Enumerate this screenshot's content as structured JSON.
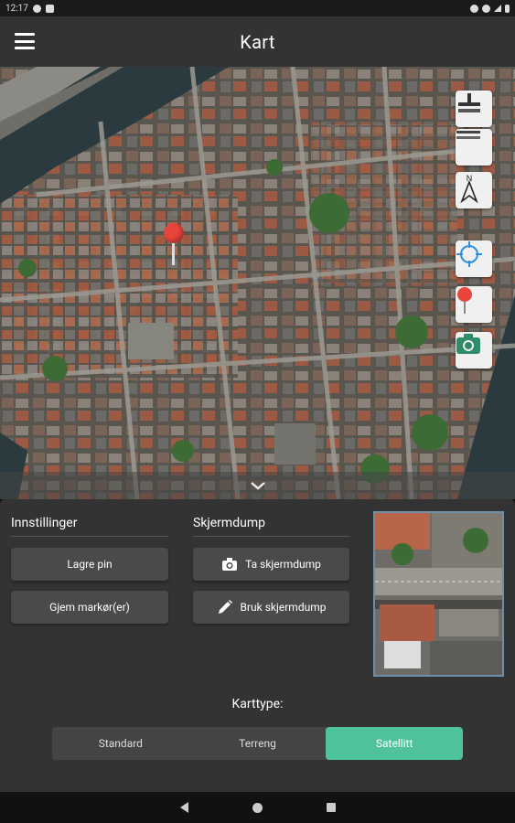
{
  "status_bar": {
    "time": "12:17"
  },
  "app_bar": {
    "title": "Kart"
  },
  "map": {
    "controls": [
      {
        "name": "zoom-control",
        "icon": "zoom-plus-minus-icon"
      },
      {
        "name": "layers-control",
        "icon": "layers-icon"
      },
      {
        "name": "compass-control",
        "icon": "north-arrow-icon",
        "label": "N"
      },
      {
        "name": "my-location-control",
        "icon": "crosshair-icon"
      },
      {
        "name": "drop-pin-control",
        "icon": "map-pin-icon"
      },
      {
        "name": "camera-control",
        "icon": "camera-icon"
      }
    ],
    "pin_color": "#e8453c"
  },
  "panel": {
    "settings": {
      "title": "Innstillinger",
      "save_pin": "Lagre pin",
      "hide_markers": "Gjem markør(er)"
    },
    "screenshot": {
      "title": "Skjermdump",
      "take": "Ta skjermdump",
      "use": "Bruk skjermdump"
    },
    "map_type": {
      "label": "Karttype:",
      "options": [
        "Standard",
        "Terreng",
        "Satellitt"
      ],
      "selected": "Satellitt"
    }
  },
  "colors": {
    "accent": "#4fc49a",
    "panel_bg": "#333333",
    "button_bg": "#4a4a4a"
  }
}
